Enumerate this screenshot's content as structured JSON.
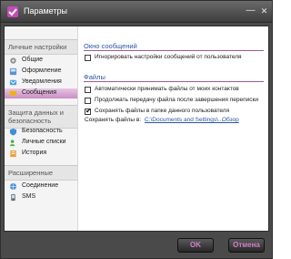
{
  "window": {
    "title": "Параметры",
    "minimize_glyph": "—",
    "close_glyph": "✕"
  },
  "sidebar": {
    "groups": [
      {
        "header": "Личные настройки",
        "items": [
          {
            "label": "Общие",
            "icon": "settings-icon"
          },
          {
            "label": "Оформление",
            "icon": "appearance-icon"
          },
          {
            "label": "Уведомления",
            "icon": "notifications-icon"
          },
          {
            "label": "Сообщения",
            "icon": "messages-icon",
            "active": true
          }
        ]
      },
      {
        "header": "Защита данных и безопасность",
        "items": [
          {
            "label": "Безопасность",
            "icon": "shield-icon"
          },
          {
            "label": "Личные списки",
            "icon": "lists-icon"
          },
          {
            "label": "История",
            "icon": "history-icon"
          }
        ]
      },
      {
        "header": "Расширенные",
        "items": [
          {
            "label": "Соединение",
            "icon": "connection-icon"
          },
          {
            "label": "SMS",
            "icon": "sms-icon"
          }
        ]
      }
    ]
  },
  "main": {
    "messages_section": {
      "title": "Окно сообщений",
      "options": [
        {
          "label": "Игнорировать настройки сообщений от пользователя",
          "checked": false
        }
      ]
    },
    "files_section": {
      "title": "Файлы",
      "options": [
        {
          "label": "Автоматически принимать файлы от моих контактов",
          "checked": false
        },
        {
          "label": "Продолжать передачу файла после завершения переписки",
          "checked": false
        },
        {
          "label": "Сохранять файлы в папке данного пользователя",
          "checked": true
        }
      ],
      "save_label": "Сохранять файлы в:",
      "save_path": "C:\\Documents and Settings\\...",
      "browse_label": "Обзор"
    }
  },
  "footer": {
    "ok_label": "OK",
    "cancel_label": "Отмена"
  },
  "colors": {
    "accent": "#d080c9",
    "link": "#2b55a3",
    "active_item": "#c98fc2",
    "window_frame": "#4a4a4a"
  }
}
